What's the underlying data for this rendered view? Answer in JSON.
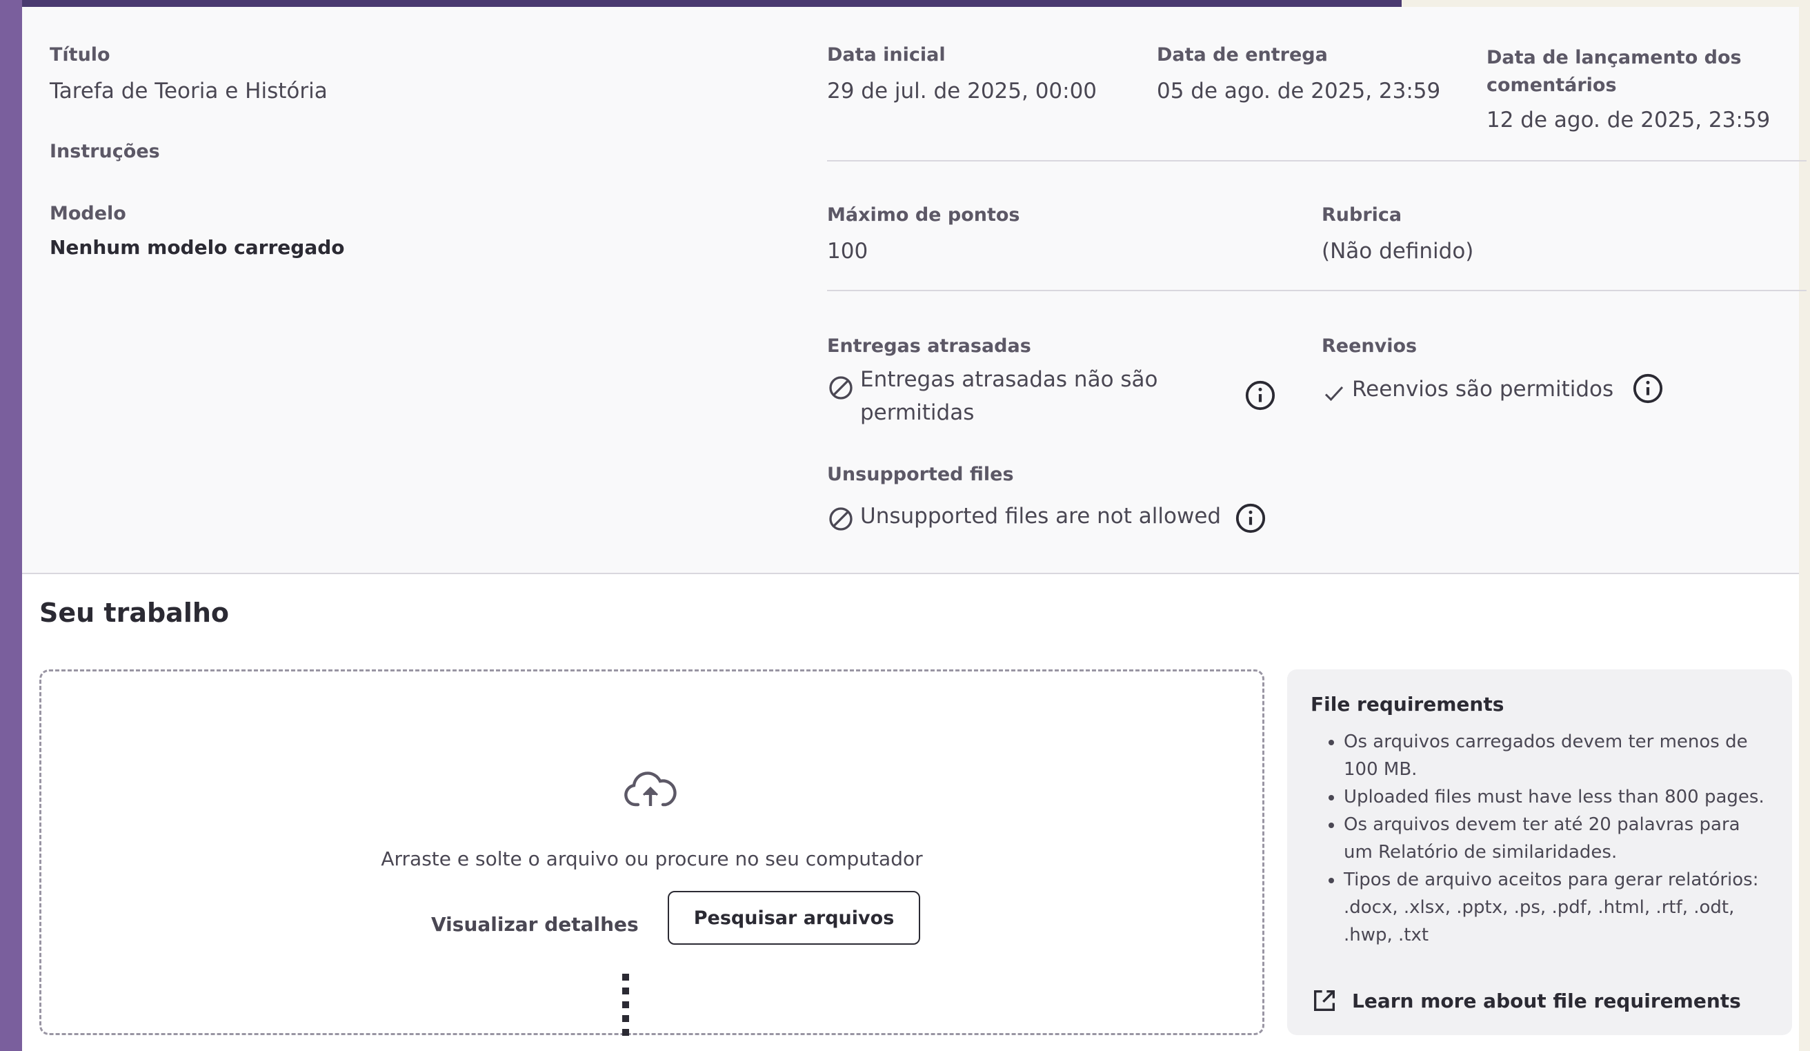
{
  "details": {
    "title_label": "Título",
    "title_value": "Tarefa de Teoria e História",
    "instructions_label": "Instruções",
    "model_label": "Modelo",
    "model_value": "Nenhum modelo carregado",
    "start_label": "Data inicial",
    "start_value": "29 de jul. de 2025, 00:00",
    "due_label": "Data de entrega",
    "due_value": "05 de ago. de 2025, 23:59",
    "feedback_label_line1": "Data de lançamento dos",
    "feedback_label_line2": "comentários",
    "feedback_value": "12 de ago. de 2025, 23:59",
    "max_points_label": "Máximo de pontos",
    "max_points_value": "100",
    "rubric_label": "Rubrica",
    "rubric_value": "(Não definido)",
    "late_label": "Entregas atrasadas",
    "late_value_line1": "Entregas atrasadas não são",
    "late_value_line2": "permitidas",
    "resubmit_label": "Reenvios",
    "resubmit_value": "Reenvios são permitidos",
    "unsupported_label": "Unsupported files",
    "unsupported_value": "Unsupported files are not allowed"
  },
  "work": {
    "section_title": "Seu trabalho",
    "drop_text": "Arraste e solte o arquivo ou procure no seu computador",
    "view_details": "Visualizar detalhes",
    "browse_button": "Pesquisar arquivos"
  },
  "requirements": {
    "title": "File requirements",
    "items": [
      "Os arquivos carregados devem ter menos de 100 MB.",
      "Uploaded files must have less than 800 pages.",
      "Os arquivos devem ter até 20 palavras para um Relatório de similaridades.",
      "Tipos de arquivo aceitos para gerar relatórios: .docx, .xlsx, .pptx, .ps, .pdf, .html, .rtf, .odt, .hwp, .txt"
    ],
    "learn_more": "Learn more about file requirements"
  },
  "icons": {
    "not_allowed": "ban-icon",
    "check": "check-icon",
    "info": "info-icon",
    "upload": "cloud-upload-icon",
    "external": "external-link-icon"
  },
  "colors": {
    "accent_bar": "#7a5f9d",
    "banner": "#4a3a70",
    "text_dark": "#2b2a33"
  }
}
